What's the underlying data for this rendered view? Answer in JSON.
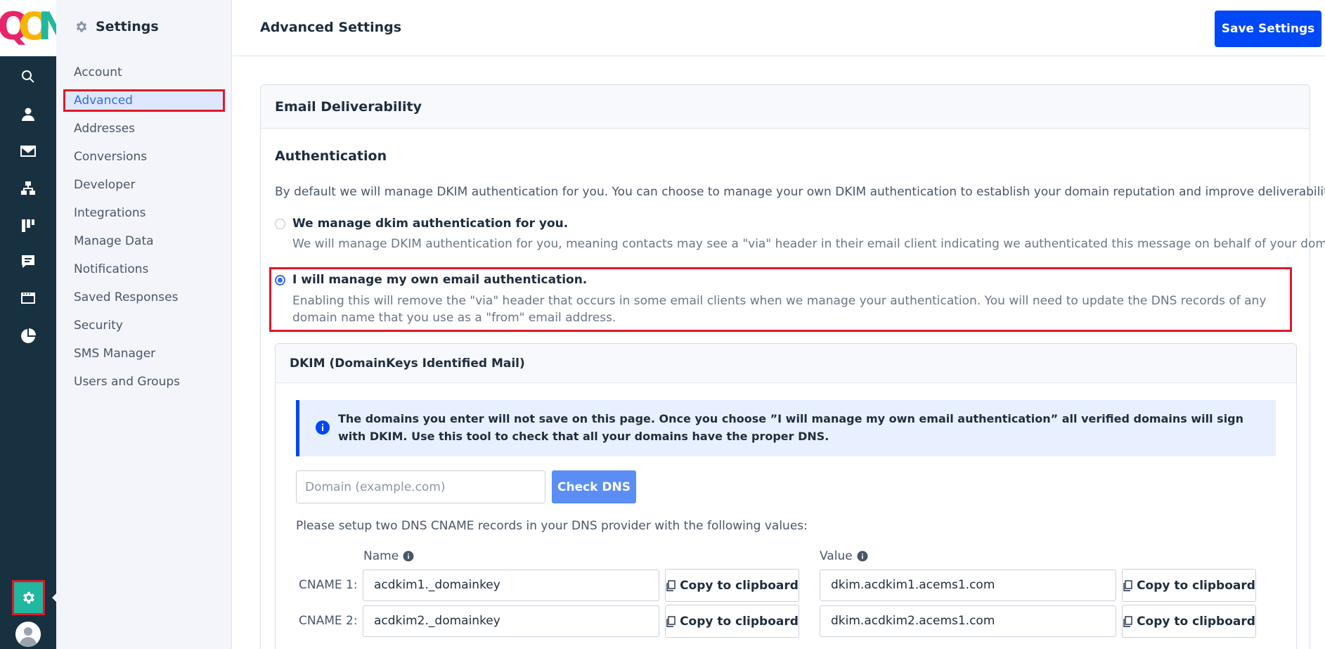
{
  "app": {
    "logo_letters": [
      "Q",
      "O",
      "N"
    ],
    "logo_colors": [
      "#e8246b",
      "#f7b500",
      "#20b8a0"
    ]
  },
  "rail": {
    "icons": [
      "search-icon",
      "contacts-icon",
      "email-icon",
      "automations-icon",
      "pipelines-icon",
      "conversations-icon",
      "site-icon",
      "reports-icon"
    ],
    "active": "settings-gear-icon"
  },
  "settings_nav": {
    "title": "Settings",
    "items": [
      {
        "label": "Account"
      },
      {
        "label": "Advanced",
        "active": true
      },
      {
        "label": "Addresses"
      },
      {
        "label": "Conversions"
      },
      {
        "label": "Developer"
      },
      {
        "label": "Integrations"
      },
      {
        "label": "Manage Data"
      },
      {
        "label": "Notifications"
      },
      {
        "label": "Saved Responses"
      },
      {
        "label": "Security"
      },
      {
        "label": "SMS Manager"
      },
      {
        "label": "Users and Groups"
      }
    ]
  },
  "header": {
    "title": "Advanced Settings",
    "save_label": "Save Settings"
  },
  "email_deliverability": {
    "title": "Email Deliverability",
    "auth_title": "Authentication",
    "auth_desc": "By default we will manage DKIM authentication for you. You can choose to manage your own DKIM authentication to establish your domain reputation and improve deliverability.",
    "options": [
      {
        "title": "We manage dkim authentication for you.",
        "desc": "We will manage DKIM authentication for you, meaning contacts may see a \"via\" header in their email client indicating we authenticated this message on behalf of your domain.",
        "checked": false
      },
      {
        "title": "I will manage my own email authentication.",
        "desc": "Enabling this will remove the \"via\" header that occurs in some email clients when we manage your authentication. You will need to update the DNS records of any domain name that you use as a \"from\" email address.",
        "checked": true
      }
    ]
  },
  "dkim": {
    "title": "DKIM (DomainKeys Identified Mail)",
    "info": "The domains you enter will not save on this page. Once you choose ”I will manage my own email authentication” all verified domains will sign with DKIM. Use this tool to check that all your domains have the proper DNS.",
    "domain_placeholder": "Domain (example.com)",
    "domain_value": "",
    "check_label": "Check DNS",
    "setup_text": "Please setup two DNS CNAME records in your DNS provider with the following values:",
    "name_header": "Name",
    "value_header": "Value",
    "copy_label": "Copy to clipboard",
    "records": [
      {
        "label": "CNAME 1:",
        "name": "acdkim1._domainkey",
        "value": "dkim.acdkim1.acems1.com"
      },
      {
        "label": "CNAME 2:",
        "name": "acdkim2._domainkey",
        "value": "dkim.acdkim2.acems1.com"
      }
    ]
  },
  "colors": {
    "rail": "#173140",
    "accent": "#0048f5",
    "active_gear": "#20b8a0",
    "highlight": "#e0182a"
  }
}
